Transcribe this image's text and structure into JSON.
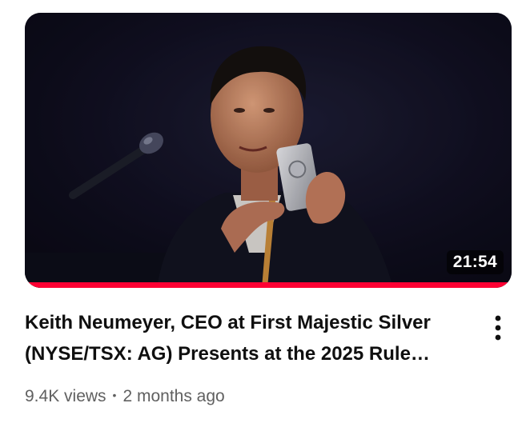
{
  "video": {
    "duration": "21:54",
    "watch_progress": 1.0,
    "progress_color": "#ff0033",
    "title": "Keith Neumeyer, CEO at First Majestic Silver (NYSE/TSX: AG) Presents at the 2025 Rule…",
    "views": "9.4K views",
    "separator": "•",
    "published": "2 months ago"
  },
  "icons": {
    "menu": "more-vert-icon"
  }
}
